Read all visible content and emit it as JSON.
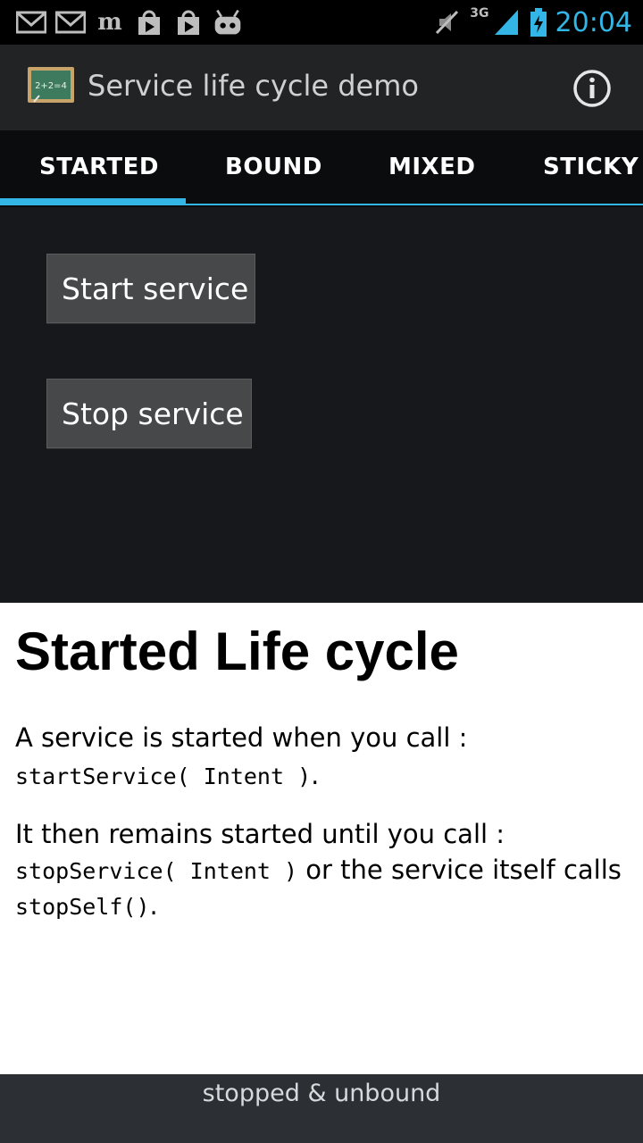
{
  "status_bar": {
    "time": "20:04",
    "network": "3G",
    "left_icons": [
      "gmail-icon",
      "gmail-icon",
      "newspaper-icon",
      "play-store-icon",
      "play-store-icon",
      "android-debug-icon"
    ],
    "right_icons": [
      "muted-icon",
      "signal-icon",
      "battery-charging-icon"
    ],
    "accent_color": "#33b5e5"
  },
  "action_bar": {
    "title": "Service life cycle demo",
    "app_icon": "chalkboard-icon",
    "app_icon_text": "2+2=4",
    "info_icon": "info-icon"
  },
  "tabs": [
    {
      "label": "STARTED",
      "selected": true
    },
    {
      "label": "BOUND",
      "selected": false
    },
    {
      "label": "MIXED",
      "selected": false
    },
    {
      "label": "STICKY",
      "selected": false
    }
  ],
  "buttons": {
    "start": "Start service",
    "stop": "Stop service"
  },
  "explanation": {
    "heading": "Started Life cycle",
    "p1_text": "A service is started when you call :",
    "p1_code": "startService( Intent )",
    "p1_end": ".",
    "p2_text": "It then remains started until you call :",
    "p2_code1": "stopService( Intent )",
    "p2_mid": " or the service itself calls",
    "p2_code2": "stopSelf()",
    "p2_end": "."
  },
  "footer": {
    "status": "stopped & unbound"
  }
}
